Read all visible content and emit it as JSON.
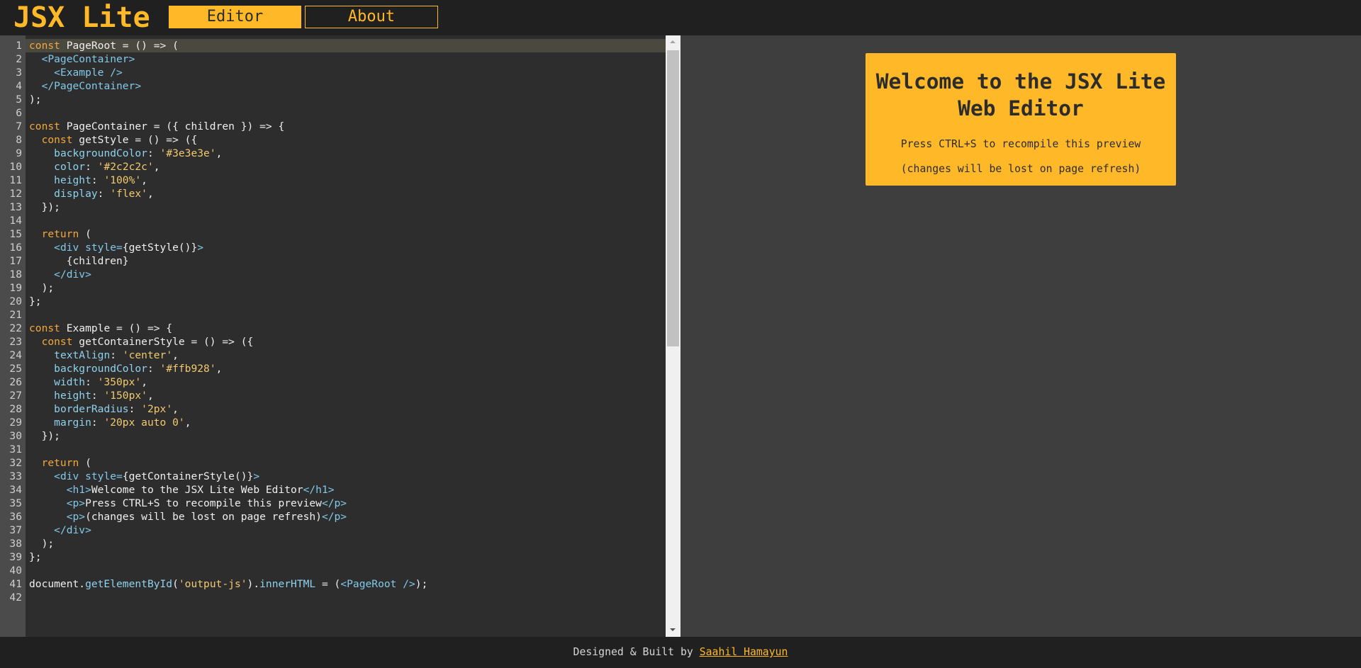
{
  "app": {
    "title": "JSX Lite"
  },
  "nav": {
    "items": [
      {
        "label": "Editor",
        "active": true
      },
      {
        "label": "About",
        "active": false
      }
    ]
  },
  "editor": {
    "active_line": 1,
    "scroll_fraction": 0,
    "lines": [
      [
        [
          "kw",
          "const"
        ],
        [
          "tx",
          " PageRoot = () => ("
        ]
      ],
      [
        [
          "tx",
          "  "
        ],
        [
          "tag",
          "<PageContainer>"
        ]
      ],
      [
        [
          "tx",
          "    "
        ],
        [
          "tag",
          "<Example />"
        ]
      ],
      [
        [
          "tx",
          "  "
        ],
        [
          "tag",
          "</PageContainer>"
        ]
      ],
      [
        [
          "tx",
          ");"
        ]
      ],
      [],
      [
        [
          "kw",
          "const"
        ],
        [
          "tx",
          " PageContainer = ({ children }) => {"
        ]
      ],
      [
        [
          "tx",
          "  "
        ],
        [
          "kw",
          "const"
        ],
        [
          "tx",
          " getStyle = () => ({"
        ]
      ],
      [
        [
          "tx",
          "    "
        ],
        [
          "prop",
          "backgroundColor"
        ],
        [
          "tx",
          ": "
        ],
        [
          "str",
          "'#3e3e3e'"
        ],
        [
          "tx",
          ","
        ]
      ],
      [
        [
          "tx",
          "    "
        ],
        [
          "prop",
          "color"
        ],
        [
          "tx",
          ": "
        ],
        [
          "str",
          "'#2c2c2c'"
        ],
        [
          "tx",
          ","
        ]
      ],
      [
        [
          "tx",
          "    "
        ],
        [
          "prop",
          "height"
        ],
        [
          "tx",
          ": "
        ],
        [
          "str",
          "'100%'"
        ],
        [
          "tx",
          ","
        ]
      ],
      [
        [
          "tx",
          "    "
        ],
        [
          "prop",
          "display"
        ],
        [
          "tx",
          ": "
        ],
        [
          "str",
          "'flex'"
        ],
        [
          "tx",
          ","
        ]
      ],
      [
        [
          "tx",
          "  });"
        ]
      ],
      [],
      [
        [
          "tx",
          "  "
        ],
        [
          "kw",
          "return"
        ],
        [
          "tx",
          " ("
        ]
      ],
      [
        [
          "tx",
          "    "
        ],
        [
          "tag",
          "<div style="
        ],
        [
          "tx",
          "{getStyle()}"
        ],
        [
          "tag",
          ">"
        ]
      ],
      [
        [
          "tx",
          "      {children}"
        ]
      ],
      [
        [
          "tx",
          "    "
        ],
        [
          "tag",
          "</div>"
        ]
      ],
      [
        [
          "tx",
          "  );"
        ]
      ],
      [
        [
          "tx",
          "};"
        ]
      ],
      [],
      [
        [
          "kw",
          "const"
        ],
        [
          "tx",
          " Example = () => {"
        ]
      ],
      [
        [
          "tx",
          "  "
        ],
        [
          "kw",
          "const"
        ],
        [
          "tx",
          " getContainerStyle = () => ({"
        ]
      ],
      [
        [
          "tx",
          "    "
        ],
        [
          "prop",
          "textAlign"
        ],
        [
          "tx",
          ": "
        ],
        [
          "str",
          "'center'"
        ],
        [
          "tx",
          ","
        ]
      ],
      [
        [
          "tx",
          "    "
        ],
        [
          "prop",
          "backgroundColor"
        ],
        [
          "tx",
          ": "
        ],
        [
          "str",
          "'#ffb928'"
        ],
        [
          "tx",
          ","
        ]
      ],
      [
        [
          "tx",
          "    "
        ],
        [
          "prop",
          "width"
        ],
        [
          "tx",
          ": "
        ],
        [
          "str",
          "'350px'"
        ],
        [
          "tx",
          ","
        ]
      ],
      [
        [
          "tx",
          "    "
        ],
        [
          "prop",
          "height"
        ],
        [
          "tx",
          ": "
        ],
        [
          "str",
          "'150px'"
        ],
        [
          "tx",
          ","
        ]
      ],
      [
        [
          "tx",
          "    "
        ],
        [
          "prop",
          "borderRadius"
        ],
        [
          "tx",
          ": "
        ],
        [
          "str",
          "'2px'"
        ],
        [
          "tx",
          ","
        ]
      ],
      [
        [
          "tx",
          "    "
        ],
        [
          "prop",
          "margin"
        ],
        [
          "tx",
          ": "
        ],
        [
          "str",
          "'20px auto 0'"
        ],
        [
          "tx",
          ","
        ]
      ],
      [
        [
          "tx",
          "  });"
        ]
      ],
      [],
      [
        [
          "tx",
          "  "
        ],
        [
          "kw",
          "return"
        ],
        [
          "tx",
          " ("
        ]
      ],
      [
        [
          "tx",
          "    "
        ],
        [
          "tag",
          "<div style="
        ],
        [
          "tx",
          "{getContainerStyle()}"
        ],
        [
          "tag",
          ">"
        ]
      ],
      [
        [
          "tx",
          "      "
        ],
        [
          "tag",
          "<h1>"
        ],
        [
          "tx",
          "Welcome to the JSX Lite Web Editor"
        ],
        [
          "tag",
          "</h1>"
        ]
      ],
      [
        [
          "tx",
          "      "
        ],
        [
          "tag",
          "<p>"
        ],
        [
          "tx",
          "Press CTRL+S to recompile this preview"
        ],
        [
          "tag",
          "</p>"
        ]
      ],
      [
        [
          "tx",
          "      "
        ],
        [
          "tag",
          "<p>"
        ],
        [
          "tx",
          "(changes will be lost on page refresh)"
        ],
        [
          "tag",
          "</p>"
        ]
      ],
      [
        [
          "tx",
          "    "
        ],
        [
          "tag",
          "</div>"
        ]
      ],
      [
        [
          "tx",
          "  );"
        ]
      ],
      [
        [
          "tx",
          "};"
        ]
      ],
      [],
      [
        [
          "tx",
          "document."
        ],
        [
          "fn",
          "getElementById"
        ],
        [
          "tx",
          "("
        ],
        [
          "str",
          "'output-js'"
        ],
        [
          "tx",
          ")."
        ],
        [
          "fn",
          "innerHTML"
        ],
        [
          "tx",
          " = ("
        ],
        [
          "tag",
          "<PageRoot />"
        ],
        [
          "tx",
          ");"
        ]
      ],
      []
    ]
  },
  "preview": {
    "heading": "Welcome to the JSX Lite Web Editor",
    "paragraphs": [
      "Press CTRL+S to recompile this preview",
      "(changes will be lost on page refresh)"
    ]
  },
  "footer": {
    "text": "Designed & Built by ",
    "author": "Saahil Hamayun"
  },
  "colors": {
    "accent": "#ffb928",
    "header_bg": "#202020",
    "editor_bg": "#2d2d2d",
    "gutter_bg": "#4b4b4b",
    "preview_bg": "#3e3e3e",
    "card_text": "#2c2c2c"
  }
}
